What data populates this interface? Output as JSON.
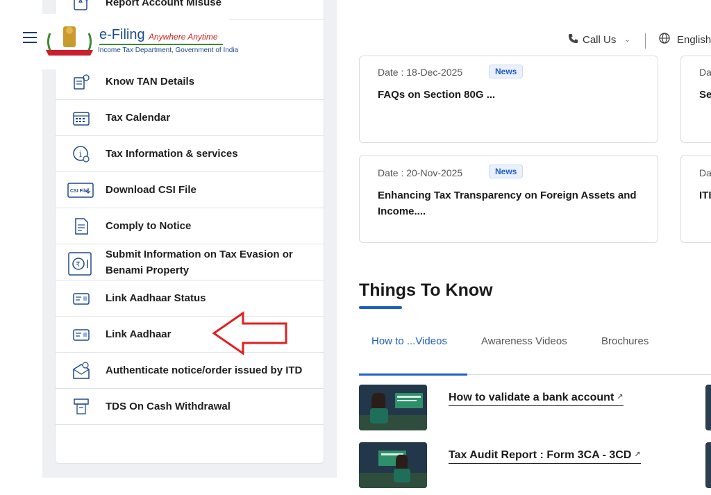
{
  "header": {
    "brand_title": "e-Filing",
    "brand_tagline": "Anywhere Anytime",
    "brand_subtitle": "Income Tax Department, Government of India",
    "call_us": "Call Us",
    "language": "English"
  },
  "quick_links": [
    {
      "label": "Report Account Misuse",
      "icon": "report-icon"
    },
    {
      "label": "Know TAN Details",
      "icon": "tan-icon"
    },
    {
      "label": "Tax Calendar",
      "icon": "calendar-icon"
    },
    {
      "label": "Tax Information & services",
      "icon": "info-icon"
    },
    {
      "label": "Download CSI File",
      "icon": "csi-file-icon",
      "icon_text": "CSI File"
    },
    {
      "label": "Comply to Notice",
      "icon": "notice-icon"
    },
    {
      "label": "Submit Information on Tax Evasion or Benami Property",
      "icon": "safe-icon"
    },
    {
      "label": "Link Aadhaar Status",
      "icon": "aadhaar-card-icon"
    },
    {
      "label": "Link Aadhaar",
      "icon": "aadhaar-card-icon"
    },
    {
      "label": "Authenticate notice/order issued by ITD",
      "icon": "envelope-check-icon"
    },
    {
      "label": "TDS On Cash Withdrawal",
      "icon": "atm-icon"
    }
  ],
  "news": [
    {
      "date": "Date : 18-Dec-2025",
      "badge": "News",
      "title": "FAQs on Section 80G ..."
    },
    {
      "date": "Date : 20-Nov-2025",
      "badge": "News",
      "title": "Enhancing Tax Transparency on Foreign Assets and Income...."
    }
  ],
  "news_right": [
    {
      "date": "Da",
      "title": "Se"
    },
    {
      "date": "Da",
      "title": "ITI"
    }
  ],
  "things_to_know": {
    "title": "Things To Know",
    "tabs": [
      "How to ...Videos",
      "Awareness Videos",
      "Brochures"
    ],
    "active_tab": 0,
    "videos": [
      {
        "title": "How to validate a bank account"
      },
      {
        "title": "Tax Audit Report : Form 3CA - 3CD"
      }
    ]
  },
  "colors": {
    "accent": "#1e5ec8",
    "brand_blue": "#1e4a8c",
    "tagline_red": "#d11e1e",
    "arrow_red": "#e02020"
  }
}
